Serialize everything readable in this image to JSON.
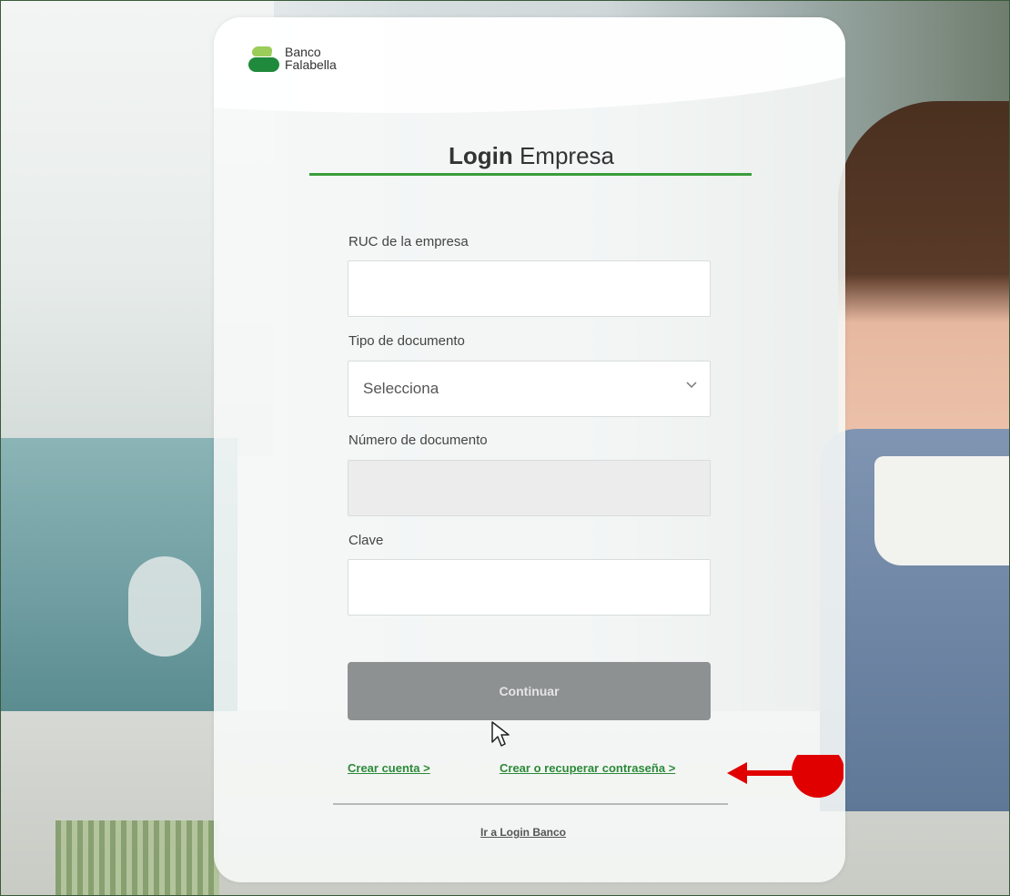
{
  "brand": {
    "line1": "Banco",
    "line2": "Falabella"
  },
  "title": {
    "bold": "Login",
    "regular": "Empresa"
  },
  "form": {
    "ruc_label": "RUC de la empresa",
    "ruc_value": "",
    "doc_type_label": "Tipo de documento",
    "doc_type_selected": "Selecciona",
    "doc_number_label": "Número de documento",
    "doc_number_value": "",
    "password_label": "Clave",
    "password_value": "",
    "continue_label": "Continuar"
  },
  "links": {
    "create_account": "Crear cuenta >",
    "recover_password": "Crear o recuperar contraseña >",
    "go_bank": "Ir a Login Banco"
  },
  "colors": {
    "accent_green": "#2c8a3a",
    "annotation_red": "#e00000",
    "button_disabled": "#8e9191"
  },
  "icons": {
    "dropdown": "chevron-down-icon",
    "cursor": "mouse-pointer-icon",
    "annotation": "red-arrow-annotation"
  }
}
